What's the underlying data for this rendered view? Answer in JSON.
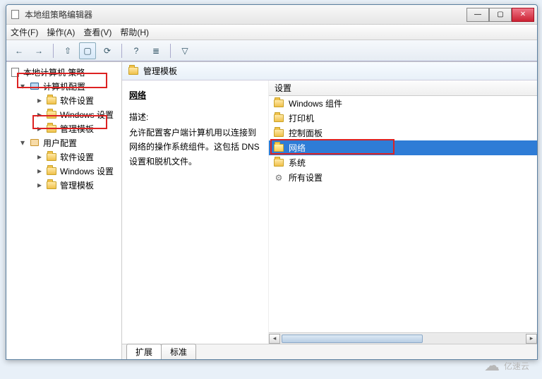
{
  "window": {
    "title": "本地组策略编辑器"
  },
  "menubar": {
    "file": "文件(F)",
    "action": "操作(A)",
    "view": "查看(V)",
    "help": "帮助(H)"
  },
  "toolbar": {
    "back": "←",
    "forward": "→",
    "up": "⇧",
    "props": "▢",
    "refresh": "⟳",
    "help": "?",
    "list": "≣",
    "filter": "▽"
  },
  "tree": {
    "root": "本地计算机 策略",
    "computer": "计算机配置",
    "computer_children": {
      "software": "软件设置",
      "windows": "Windows 设置",
      "admin": "管理模板"
    },
    "user": "用户配置",
    "user_children": {
      "software": "软件设置",
      "windows": "Windows 设置",
      "admin": "管理模板"
    }
  },
  "breadcrumb": {
    "label": "管理模板"
  },
  "description": {
    "title": "网络",
    "label": "描述:",
    "text": "允许配置客户端计算机用以连接到网络的操作系统组件。这包括 DNS 设置和脱机文件。"
  },
  "list": {
    "header": "设置",
    "items": [
      {
        "label": "Windows 组件",
        "icon": "folder"
      },
      {
        "label": "打印机",
        "icon": "folder"
      },
      {
        "label": "控制面板",
        "icon": "folder"
      },
      {
        "label": "网络",
        "icon": "folder",
        "selected": true
      },
      {
        "label": "系统",
        "icon": "folder"
      },
      {
        "label": "所有设置",
        "icon": "settings"
      }
    ]
  },
  "tabs": {
    "extended": "扩展",
    "standard": "标准"
  },
  "watermark": "亿速云"
}
